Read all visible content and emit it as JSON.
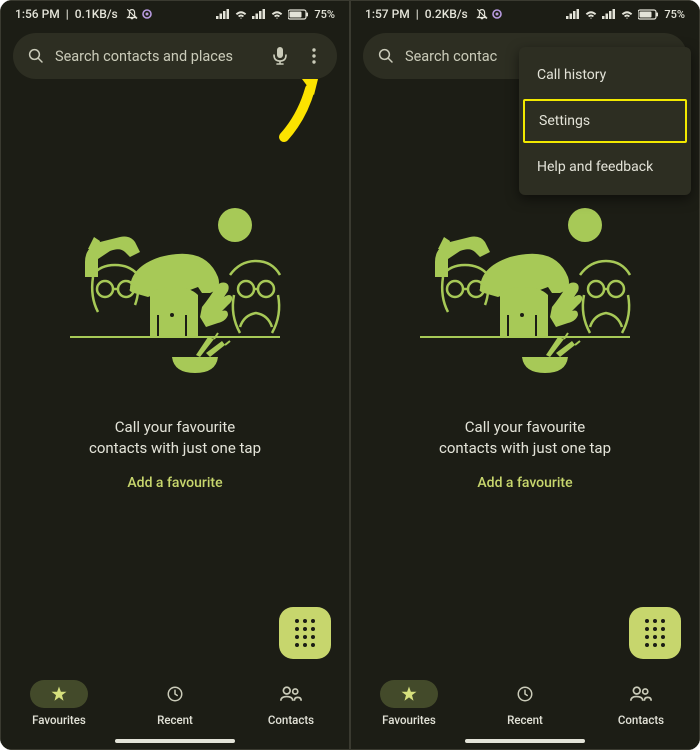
{
  "left": {
    "status": {
      "time": "1:56 PM",
      "speed": "0.1KB/s",
      "battery": "75%"
    },
    "search_placeholder": "Search contacts and places",
    "main_line1": "Call your favourite",
    "main_line2": "contacts with just one tap",
    "add_favourite": "Add a favourite",
    "nav": {
      "favourites": "Favourites",
      "recent": "Recent",
      "contacts": "Contacts"
    }
  },
  "right": {
    "status": {
      "time": "1:57 PM",
      "speed": "0.2KB/s",
      "battery": "75%"
    },
    "search_placeholder": "Search contac",
    "main_line1": "Call your favourite",
    "main_line2": "contacts with just one tap",
    "add_favourite": "Add a favourite",
    "menu": {
      "history": "Call history",
      "settings": "Settings",
      "help": "Help and feedback"
    },
    "nav": {
      "favourites": "Favourites",
      "recent": "Recent",
      "contacts": "Contacts"
    }
  }
}
